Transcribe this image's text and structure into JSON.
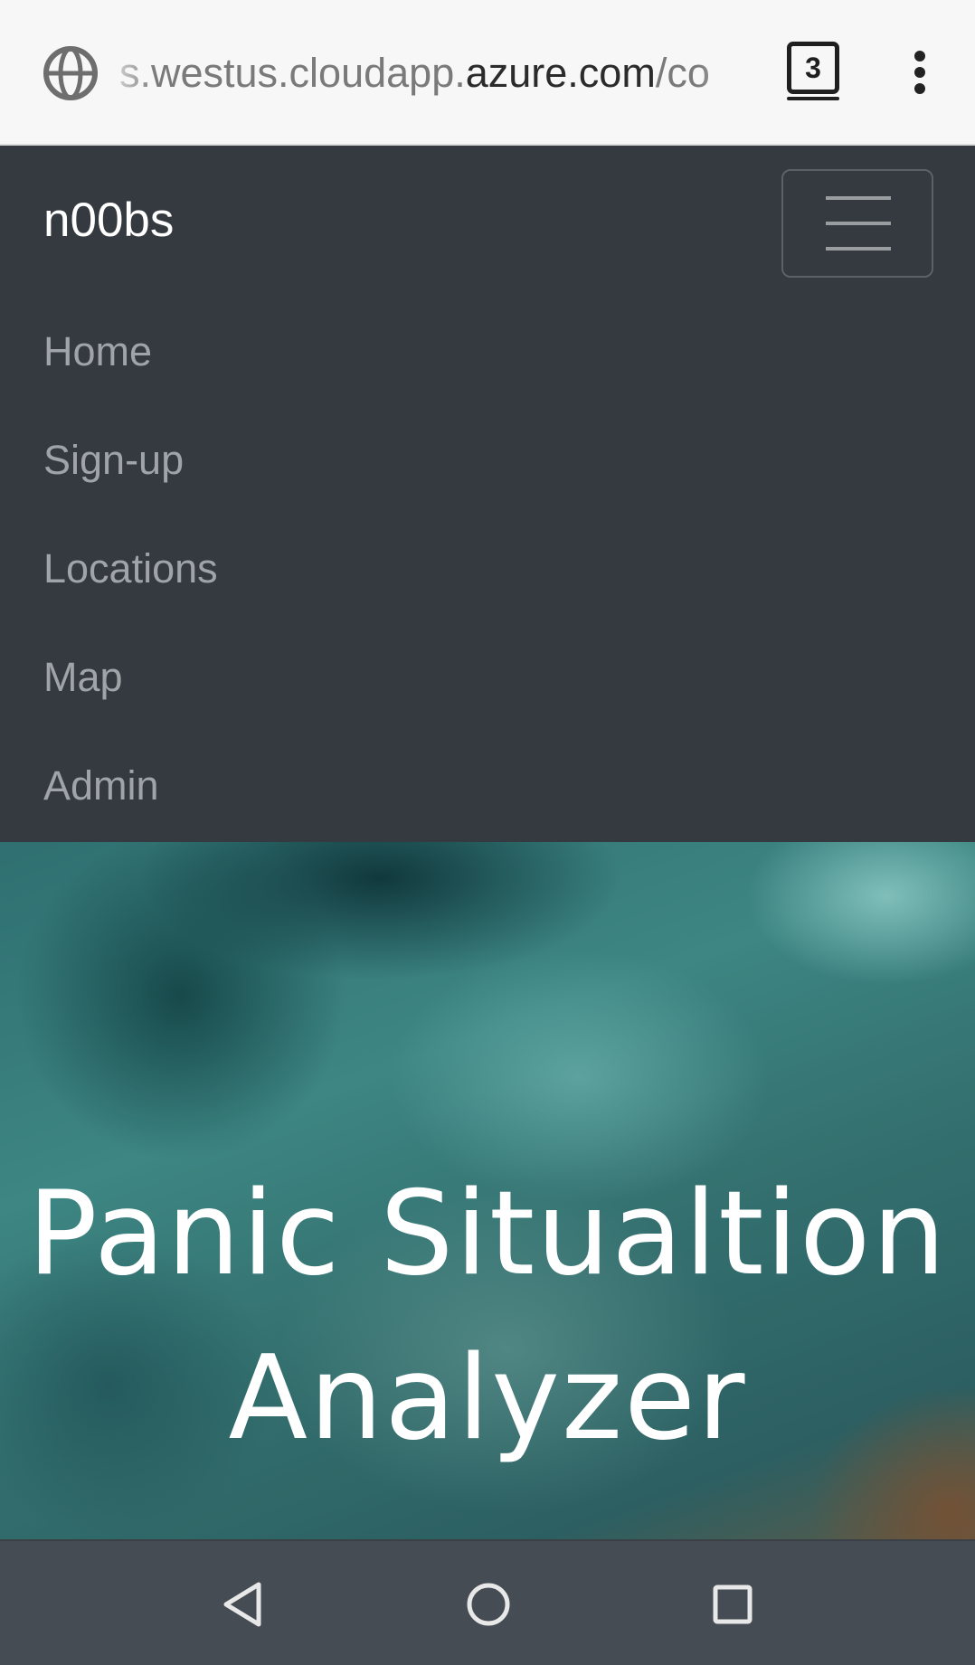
{
  "browser": {
    "url_prefix": "s.westus.cloudapp.",
    "url_domain": "azure.com",
    "url_suffix": "/co",
    "tab_count": "3",
    "icons": {
      "site": "globe-icon",
      "tabs": "tab-switcher-icon",
      "menu": "more-vertical-icon"
    }
  },
  "navbar": {
    "brand": "n00bs",
    "toggler_icon": "hamburger-icon",
    "items": [
      {
        "label": "Home"
      },
      {
        "label": "Sign-up"
      },
      {
        "label": "Locations"
      },
      {
        "label": "Map"
      },
      {
        "label": "Admin"
      }
    ]
  },
  "hero": {
    "title": "Panic Situaltion Analyzer"
  },
  "system_nav": {
    "back_icon": "back-triangle-icon",
    "home_icon": "home-circle-icon",
    "recents_icon": "recents-square-icon"
  },
  "colors": {
    "navbar_bg": "#343a40",
    "brand_text": "#ffffff",
    "nav_link": "#a0a4a8",
    "system_nav_bg": "#454c53"
  }
}
